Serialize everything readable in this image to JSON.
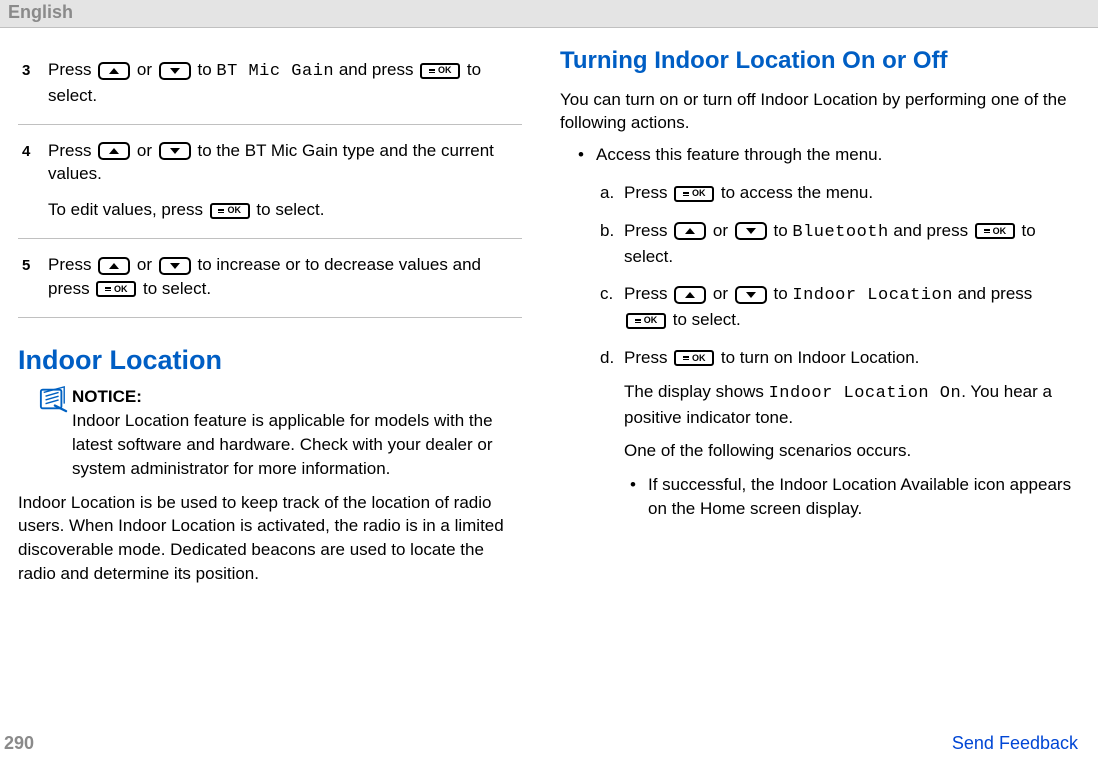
{
  "header": {
    "language": "English"
  },
  "left": {
    "steps": [
      {
        "num": "3",
        "paragraphs": [
          {
            "segments": [
              {
                "t": "Press "
              },
              {
                "key": "up"
              },
              {
                "t": " or "
              },
              {
                "key": "down"
              },
              {
                "t": " to "
              },
              {
                "mono": "BT Mic Gain"
              },
              {
                "t": " and press "
              },
              {
                "key": "ok"
              },
              {
                "t": " to select."
              }
            ]
          }
        ]
      },
      {
        "num": "4",
        "paragraphs": [
          {
            "segments": [
              {
                "t": "Press "
              },
              {
                "key": "up"
              },
              {
                "t": " or "
              },
              {
                "key": "down"
              },
              {
                "t": " to the BT Mic Gain type and the current values."
              }
            ]
          },
          {
            "segments": [
              {
                "t": "To edit values, press "
              },
              {
                "key": "ok"
              },
              {
                "t": " to select."
              }
            ]
          }
        ]
      },
      {
        "num": "5",
        "paragraphs": [
          {
            "segments": [
              {
                "t": "Press "
              },
              {
                "key": "up"
              },
              {
                "t": " or "
              },
              {
                "key": "down"
              },
              {
                "t": " to increase or to decrease values and press "
              },
              {
                "key": "ok"
              },
              {
                "t": " to select."
              }
            ]
          }
        ]
      }
    ],
    "section_title": "Indoor Location",
    "notice_label": "NOTICE:",
    "notice_body": "Indoor Location feature is applicable for models with the latest software and hardware. Check with your dealer or system administrator for more information.",
    "paragraph": "Indoor Location is be used to keep track of the location of radio users. When Indoor Location is activated, the radio is in a limited discoverable mode. Dedicated beacons are used to locate the radio and determine its position."
  },
  "right": {
    "section_title": "Turning Indoor Location On or Off",
    "intro": "You can turn on or turn off Indoor Location by performing one of the following actions.",
    "bullet": "Access this feature through the menu.",
    "sub": [
      {
        "letter": "a.",
        "paragraphs": [
          {
            "segments": [
              {
                "t": "Press "
              },
              {
                "key": "ok"
              },
              {
                "t": " to access the menu."
              }
            ]
          }
        ]
      },
      {
        "letter": "b.",
        "paragraphs": [
          {
            "segments": [
              {
                "t": "Press "
              },
              {
                "key": "up"
              },
              {
                "t": " or "
              },
              {
                "key": "down"
              },
              {
                "t": " to "
              },
              {
                "mono": "Bluetooth"
              },
              {
                "t": " and press "
              },
              {
                "key": "ok"
              },
              {
                "t": " to select."
              }
            ]
          }
        ]
      },
      {
        "letter": "c.",
        "paragraphs": [
          {
            "segments": [
              {
                "t": "Press "
              },
              {
                "key": "up"
              },
              {
                "t": " or "
              },
              {
                "key": "down"
              },
              {
                "t": " to "
              },
              {
                "mono": "Indoor Location"
              },
              {
                "t": " and press "
              },
              {
                "key": "ok"
              },
              {
                "t": " to select."
              }
            ]
          }
        ]
      },
      {
        "letter": "d.",
        "paragraphs": [
          {
            "segments": [
              {
                "t": "Press "
              },
              {
                "key": "ok"
              },
              {
                "t": " to turn on Indoor Location."
              }
            ]
          },
          {
            "segments": [
              {
                "t": "The display shows "
              },
              {
                "mono": "Indoor Location On"
              },
              {
                "t": ". You hear a positive indicator tone."
              }
            ]
          },
          {
            "segments": [
              {
                "t": "One of the following scenarios occurs."
              }
            ]
          }
        ],
        "inner_bullet": "If successful, the Indoor Location Available icon appears on the Home screen display."
      }
    ]
  },
  "footer": {
    "page": "290",
    "feedback": "Send Feedback"
  },
  "keys": {
    "ok_label": "OK"
  }
}
